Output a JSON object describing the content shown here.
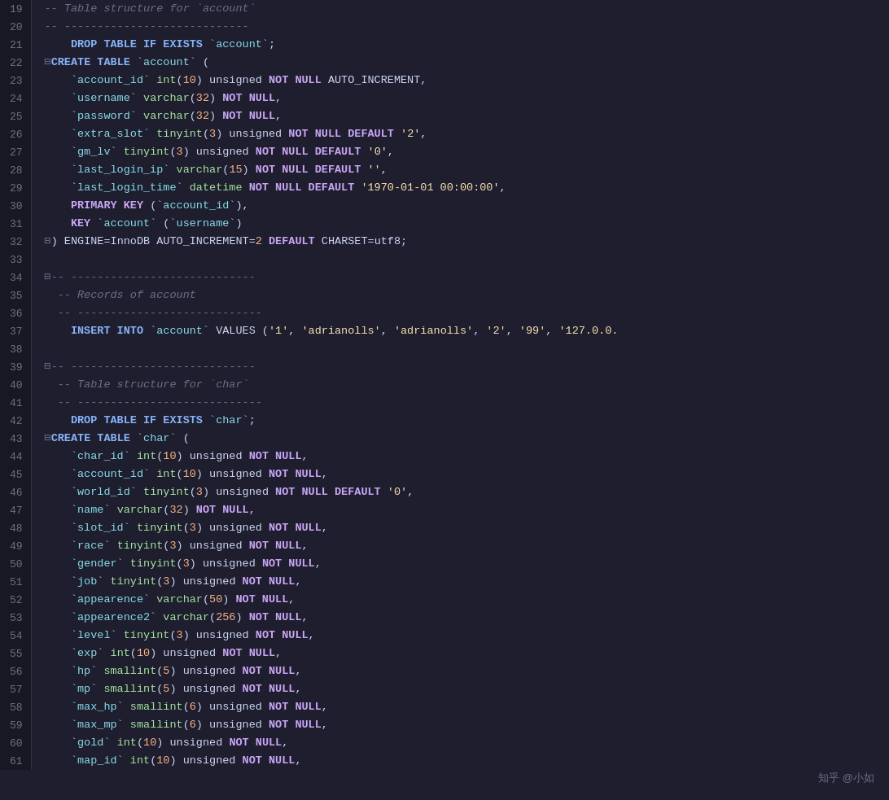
{
  "lines": [
    {
      "num": 19,
      "html": "<span class='comment'>-- Table structure for `account`</span>"
    },
    {
      "num": 20,
      "html": "<span class='comment'>-- ----------------------------</span>"
    },
    {
      "num": 21,
      "html": "    <span class='kw'>DROP TABLE IF EXISTS</span> <span class='tbl'>`account`</span>;"
    },
    {
      "num": 22,
      "html": "<span class='fold'>⊟</span><span class='kw'>CREATE TABLE</span> <span class='tbl'>`account`</span> ("
    },
    {
      "num": 23,
      "html": "    <span class='tbl'>`account_id`</span> <span class='type'>int</span>(<span class='num'>10</span>) unsigned <span class='kw2'>NOT NULL</span> AUTO_INCREMENT,"
    },
    {
      "num": 24,
      "html": "    <span class='tbl'>`username`</span> <span class='type'>varchar</span>(<span class='num'>32</span>) <span class='kw2'>NOT NULL</span>,"
    },
    {
      "num": 25,
      "html": "    <span class='tbl'>`password`</span> <span class='type'>varchar</span>(<span class='num'>32</span>) <span class='kw2'>NOT NULL</span>,"
    },
    {
      "num": 26,
      "html": "    <span class='tbl'>`extra_slot`</span> <span class='type'>tinyint</span>(<span class='num'>3</span>) unsigned <span class='kw2'>NOT NULL DEFAULT</span> <span class='str'>'2'</span>,"
    },
    {
      "num": 27,
      "html": "    <span class='tbl'>`gm_lv`</span> <span class='type'>tinyint</span>(<span class='num'>3</span>) unsigned <span class='kw2'>NOT NULL DEFAULT</span> <span class='str'>'0'</span>,"
    },
    {
      "num": 28,
      "html": "    <span class='tbl'>`last_login_ip`</span> <span class='type'>varchar</span>(<span class='num'>15</span>) <span class='kw2'>NOT NULL DEFAULT</span> <span class='str'>''</span>,"
    },
    {
      "num": 29,
      "html": "    <span class='tbl'>`last_login_time`</span> <span class='type'>datetime</span> <span class='kw2'>NOT NULL DEFAULT</span> <span class='str'>'1970-01-01 00:00:00'</span>,"
    },
    {
      "num": 30,
      "html": "    <span class='kw2'>PRIMARY KEY</span> (<span class='tbl'>`account_id`</span>),"
    },
    {
      "num": 31,
      "html": "    <span class='kw2'>KEY</span> <span class='tbl'>`account`</span> (<span class='tbl'>`username`</span>)"
    },
    {
      "num": 32,
      "html": "<span class='fold'>⊟</span>) ENGINE=InnoDB AUTO_INCREMENT=<span class='num'>2</span> <span class='kw2'>DEFAULT</span> CHARSET=utf8;"
    },
    {
      "num": 33,
      "html": ""
    },
    {
      "num": 34,
      "html": "<span class='fold'>⊟</span><span class='comment'>-- ----------------------------</span>"
    },
    {
      "num": 35,
      "html": "  <span class='comment'>-- Records of account</span>"
    },
    {
      "num": 36,
      "html": "  <span class='comment'>-- ----------------------------</span>"
    },
    {
      "num": 37,
      "html": "    <span class='kw'>INSERT INTO</span> <span class='tbl'>`account`</span> VALUES (<span class='str'>'1'</span>, <span class='str'>'adrianolls'</span>, <span class='str'>'adrianolls'</span>, <span class='str'>'2'</span>, <span class='str'>'99'</span>, <span class='str'>'127.0.0.</span>"
    },
    {
      "num": 38,
      "html": ""
    },
    {
      "num": 39,
      "html": "<span class='fold'>⊟</span><span class='comment'>-- ----------------------------</span>"
    },
    {
      "num": 40,
      "html": "  <span class='comment'>-- Table structure for `char`</span>"
    },
    {
      "num": 41,
      "html": "  <span class='comment'>-- ----------------------------</span>"
    },
    {
      "num": 42,
      "html": "    <span class='kw'>DROP TABLE IF EXISTS</span> <span class='tbl'>`char`</span>;"
    },
    {
      "num": 43,
      "html": "<span class='fold'>⊟</span><span class='kw'>CREATE TABLE</span> <span class='tbl'>`char`</span> ("
    },
    {
      "num": 44,
      "html": "    <span class='tbl'>`char_id`</span> <span class='type'>int</span>(<span class='num'>10</span>) unsigned <span class='kw2'>NOT NULL</span>,"
    },
    {
      "num": 45,
      "html": "    <span class='tbl'>`account_id`</span> <span class='type'>int</span>(<span class='num'>10</span>) unsigned <span class='kw2'>NOT NULL</span>,"
    },
    {
      "num": 46,
      "html": "    <span class='tbl'>`world_id`</span> <span class='type'>tinyint</span>(<span class='num'>3</span>) unsigned <span class='kw2'>NOT NULL DEFAULT</span> <span class='str'>'0'</span>,"
    },
    {
      "num": 47,
      "html": "    <span class='tbl'>`name`</span> <span class='type'>varchar</span>(<span class='num'>32</span>) <span class='kw2'>NOT NULL</span>,"
    },
    {
      "num": 48,
      "html": "    <span class='tbl'>`slot_id`</span> <span class='type'>tinyint</span>(<span class='num'>3</span>) unsigned <span class='kw2'>NOT NULL</span>,"
    },
    {
      "num": 49,
      "html": "    <span class='tbl'>`race`</span> <span class='type'>tinyint</span>(<span class='num'>3</span>) unsigned <span class='kw2'>NOT NULL</span>,"
    },
    {
      "num": 50,
      "html": "    <span class='tbl'>`gender`</span> <span class='type'>tinyint</span>(<span class='num'>3</span>) unsigned <span class='kw2'>NOT NULL</span>,"
    },
    {
      "num": 51,
      "html": "    <span class='tbl'>`job`</span> <span class='type'>tinyint</span>(<span class='num'>3</span>) unsigned <span class='kw2'>NOT NULL</span>,"
    },
    {
      "num": 52,
      "html": "    <span class='tbl'>`appearence`</span> <span class='type'>varchar</span>(<span class='num'>50</span>) <span class='kw2'>NOT NULL</span>,"
    },
    {
      "num": 53,
      "html": "    <span class='tbl'>`appearence2`</span> <span class='type'>varchar</span>(<span class='num'>256</span>) <span class='kw2'>NOT NULL</span>,"
    },
    {
      "num": 54,
      "html": "    <span class='tbl'>`level`</span> <span class='type'>tinyint</span>(<span class='num'>3</span>) unsigned <span class='kw2'>NOT NULL</span>,"
    },
    {
      "num": 55,
      "html": "    <span class='tbl'>`exp`</span> <span class='type'>int</span>(<span class='num'>10</span>) unsigned <span class='kw2'>NOT NULL</span>,"
    },
    {
      "num": 56,
      "html": "    <span class='tbl'>`hp`</span> <span class='type'>smallint</span>(<span class='num'>5</span>) unsigned <span class='kw2'>NOT NULL</span>,"
    },
    {
      "num": 57,
      "html": "    <span class='tbl'>`mp`</span> <span class='type'>smallint</span>(<span class='num'>5</span>) unsigned <span class='kw2'>NOT NULL</span>,"
    },
    {
      "num": 58,
      "html": "    <span class='tbl'>`max_hp`</span> <span class='type'>smallint</span>(<span class='num'>6</span>) unsigned <span class='kw2'>NOT NULL</span>,"
    },
    {
      "num": 59,
      "html": "    <span class='tbl'>`max_mp`</span> <span class='type'>smallint</span>(<span class='num'>6</span>) unsigned <span class='kw2'>NOT NULL</span>,"
    },
    {
      "num": 60,
      "html": "    <span class='tbl'>`gold`</span> <span class='type'>int</span>(<span class='num'>10</span>) unsigned <span class='kw2'>NOT NULL</span>,"
    },
    {
      "num": 61,
      "html": "    <span class='tbl'>`map_id`</span> <span class='type'>int</span>(<span class='num'>10</span>) unsigned <span class='kw2'>NOT NULL</span>,"
    }
  ],
  "watermark": "知乎 @小如"
}
